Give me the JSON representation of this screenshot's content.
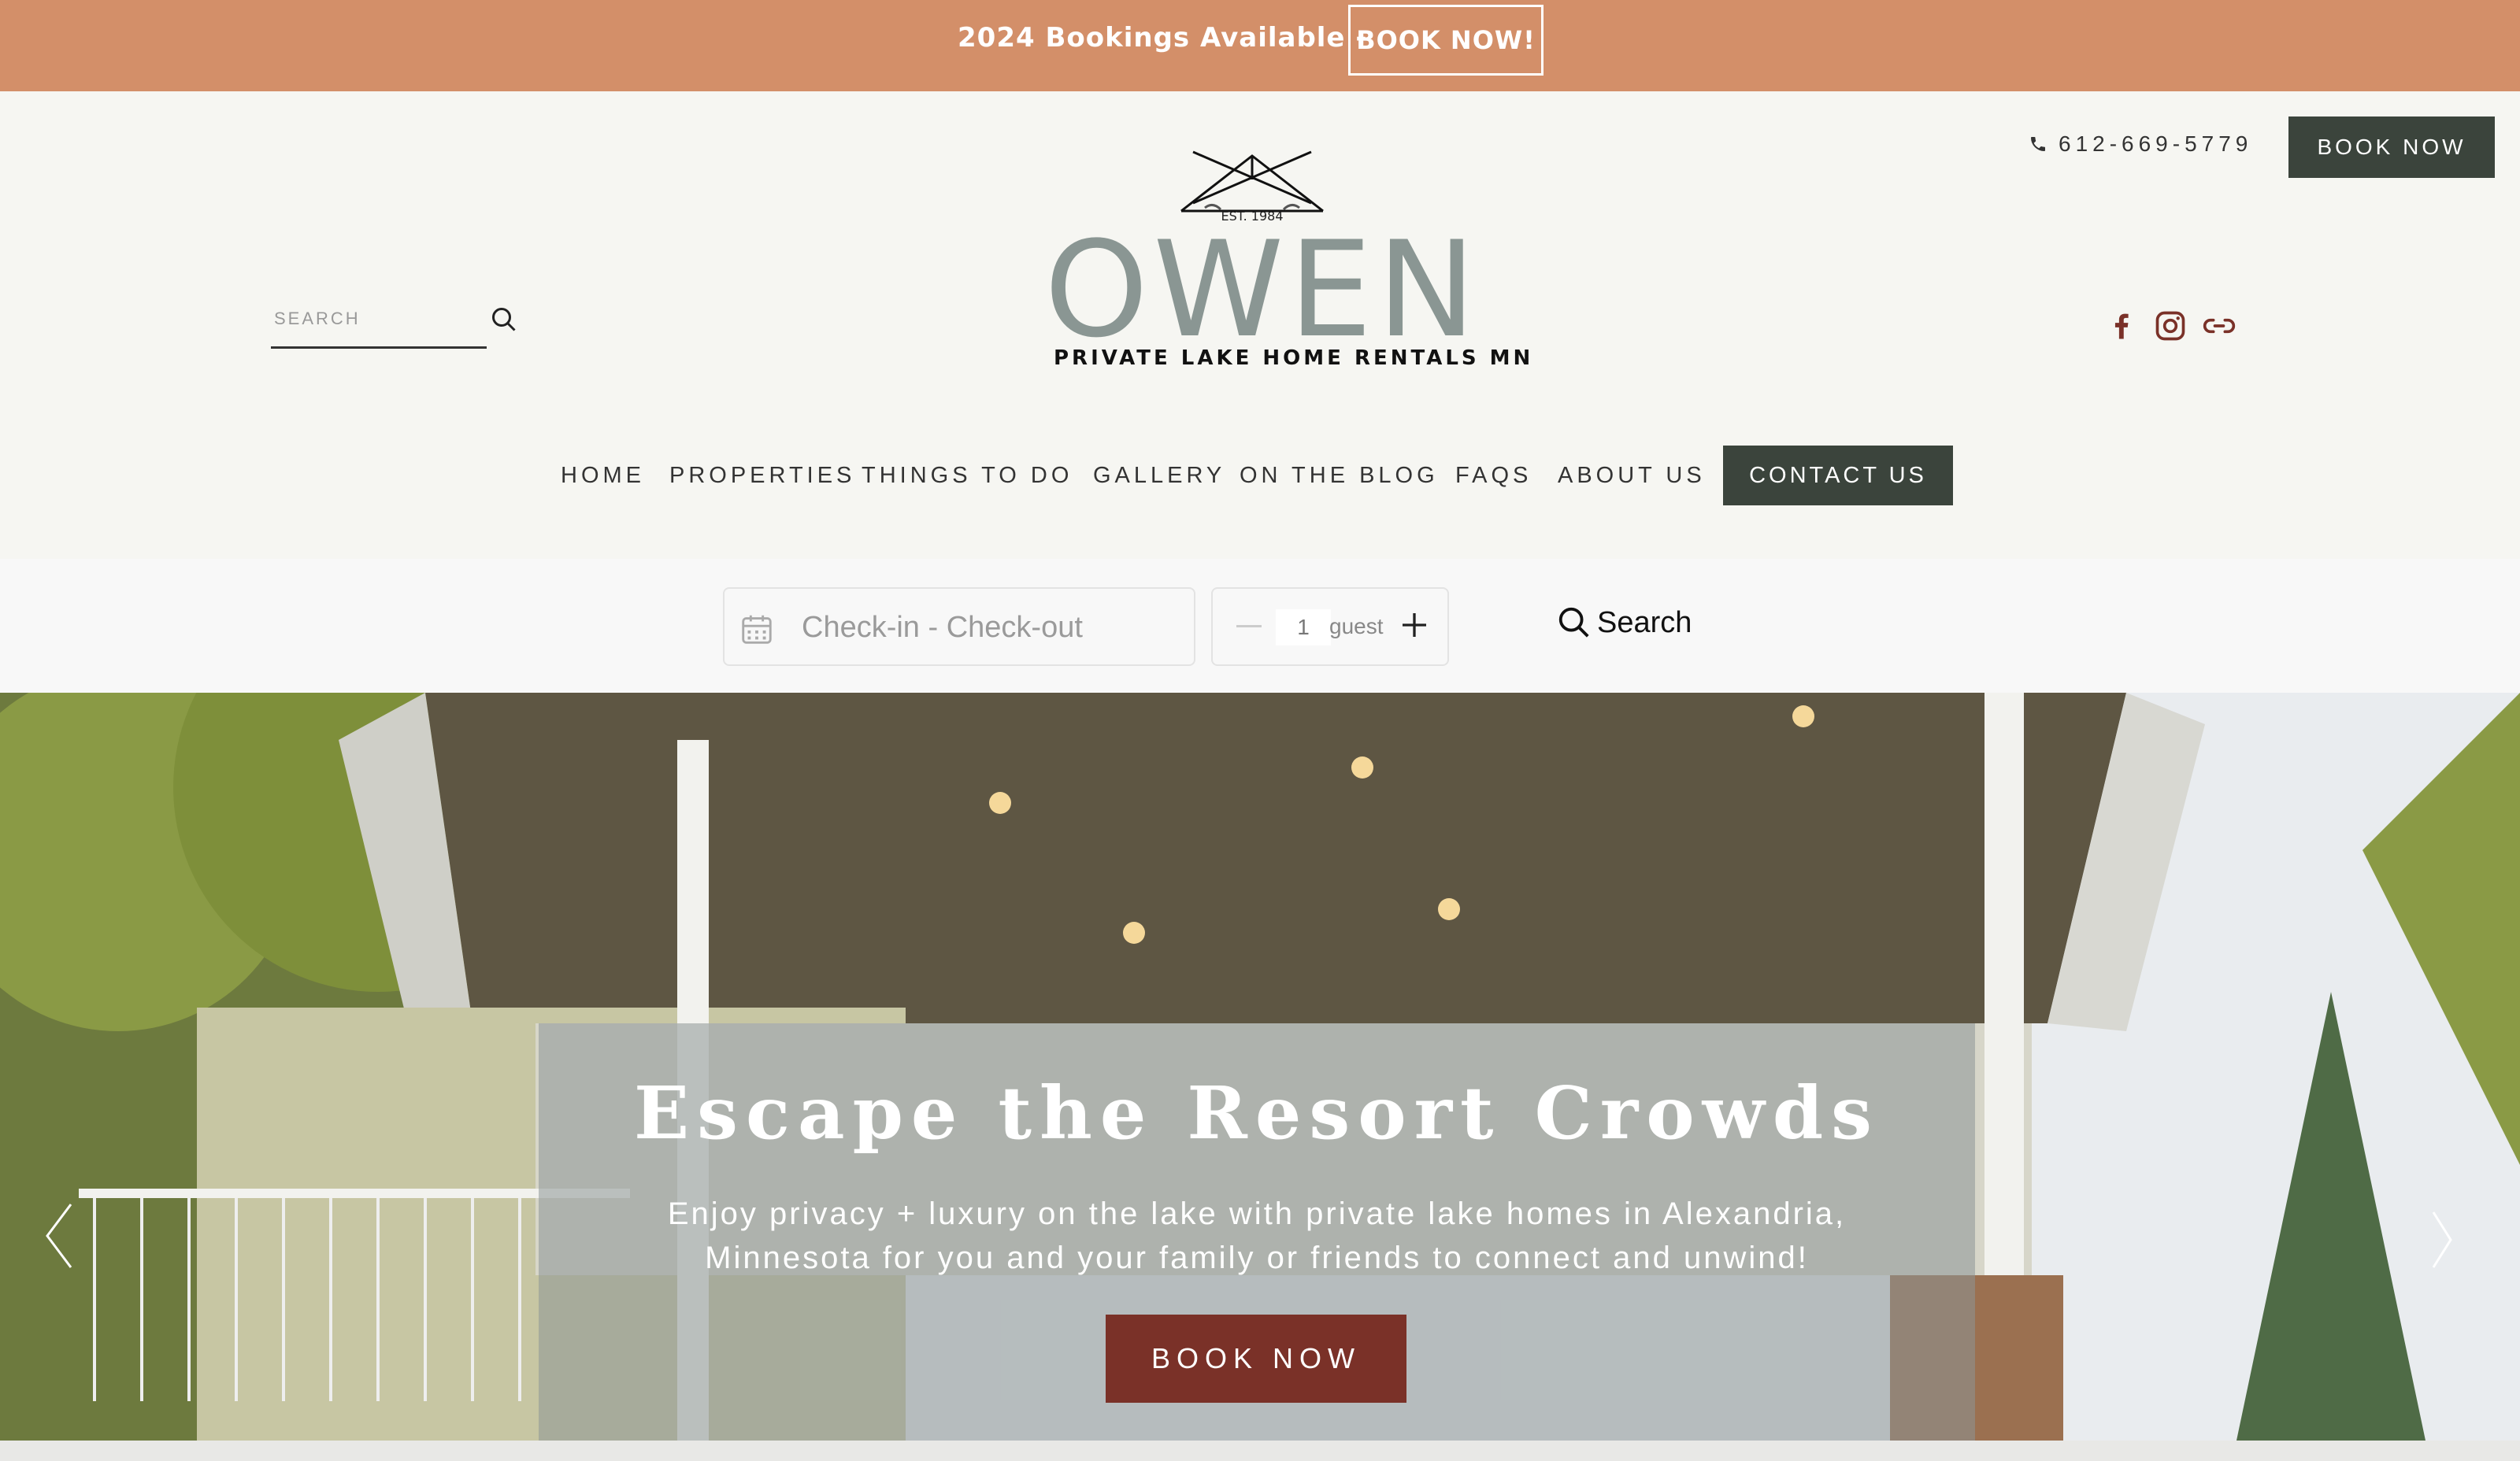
{
  "promo": {
    "text": "2024 Bookings Available -",
    "button": "BOOK NOW!"
  },
  "header": {
    "phone": "612-669-5779",
    "book_button": "BOOK NOW",
    "search_placeholder": "SEARCH",
    "logo": {
      "name": "OWEN",
      "tagline": "PRIVATE LAKE HOME RENTALS MN",
      "est": "EST. 1984"
    },
    "social": [
      "facebook-icon",
      "instagram-icon",
      "link-icon"
    ]
  },
  "nav": {
    "items": [
      "HOME",
      "PROPERTIES",
      "THINGS TO DO",
      "GALLERY",
      "ON THE BLOG",
      "FAQS",
      "ABOUT US"
    ],
    "contact": "CONTACT US"
  },
  "booking": {
    "date_placeholder": "Check-in - Check-out",
    "guest_count": "1",
    "guest_label": "guest",
    "search_label": "Search"
  },
  "hero": {
    "title": "Escape the Resort Crowds",
    "text_line1": "Enjoy privacy + luxury on the lake with private lake homes in Alexandria,",
    "text_line2": "Minnesota for you and your family or friends to connect and unwind!",
    "button": "BOOK NOW"
  },
  "colors": {
    "promo": "#d38f69",
    "dark": "#3b443c",
    "accent": "#7a3128",
    "logo": "#8a9693"
  }
}
